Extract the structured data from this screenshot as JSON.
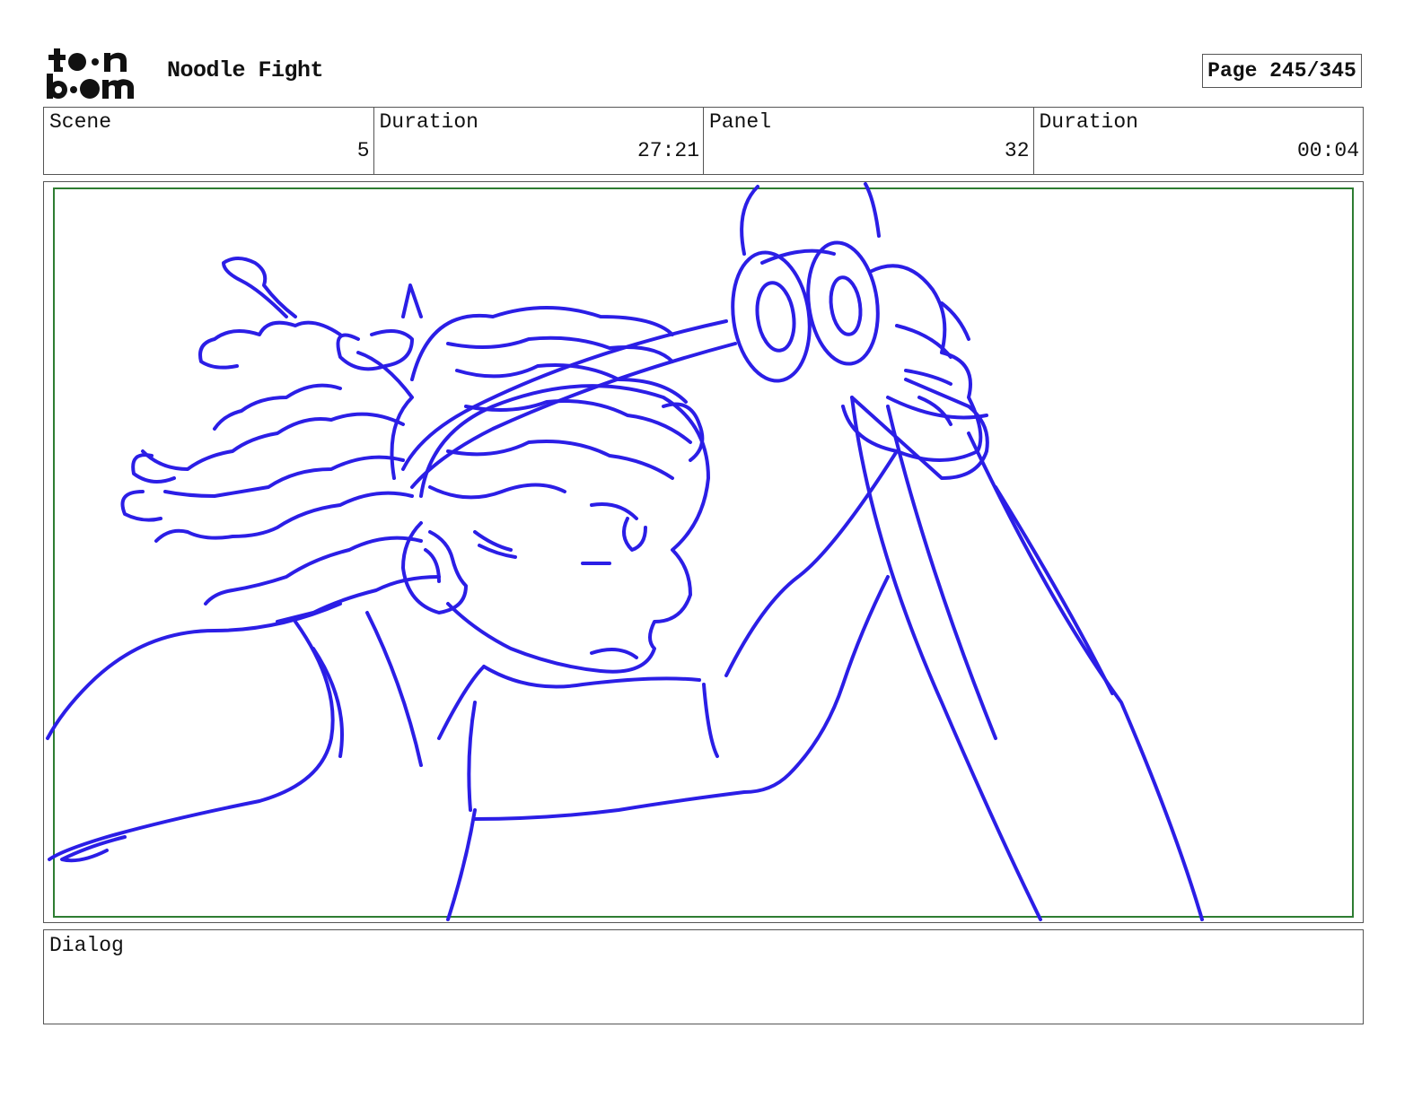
{
  "header": {
    "logo_text": "toon boom",
    "project_title": "Noodle Fight",
    "page_label": "Page 245/345"
  },
  "info": [
    {
      "label": "Scene",
      "value": "5"
    },
    {
      "label": "Duration",
      "value": "27:21"
    },
    {
      "label": "Panel",
      "value": "32"
    },
    {
      "label": "Duration",
      "value": "00:04"
    }
  ],
  "panel": {
    "sketch_color": "#2b1ee6",
    "safe_frame_color": "#2e7d32"
  },
  "dialog": {
    "label": "Dialog",
    "text": ""
  }
}
